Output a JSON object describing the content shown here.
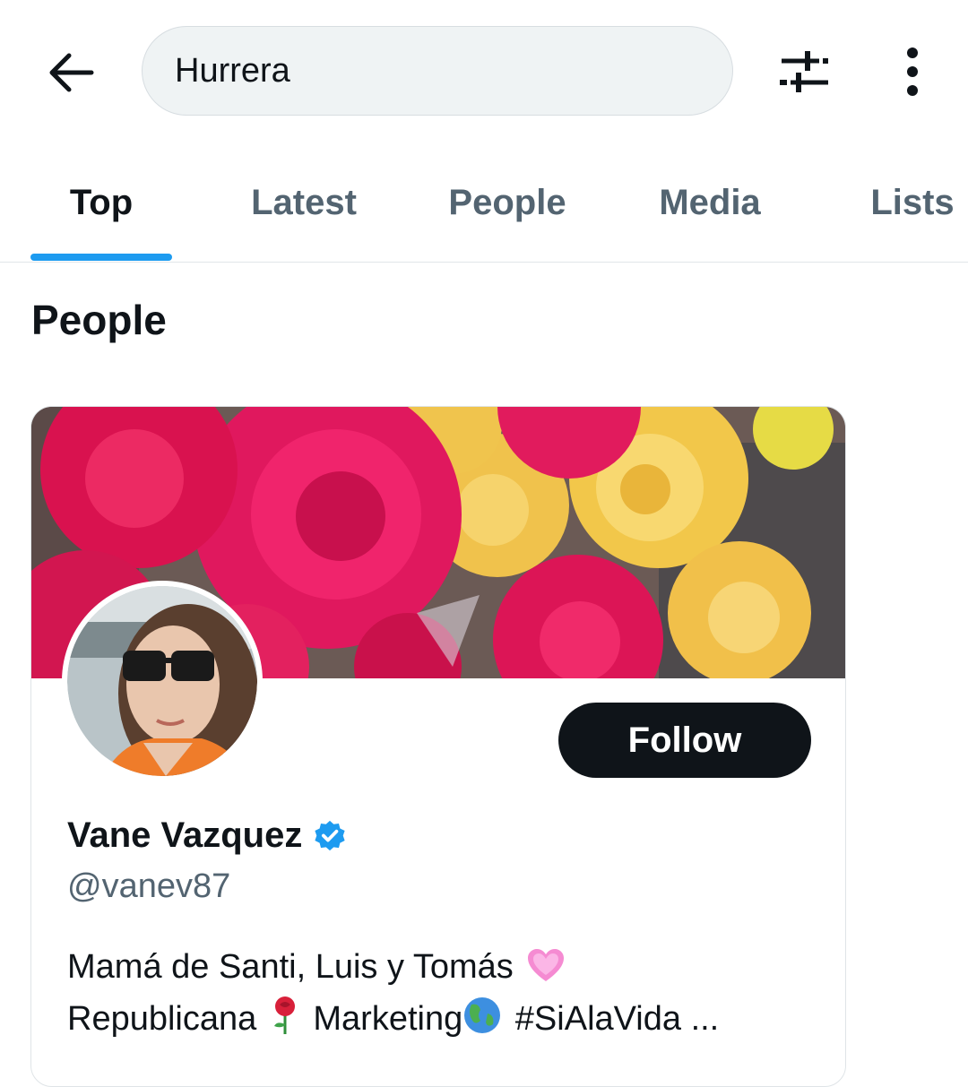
{
  "search": {
    "query": "Hurrera"
  },
  "tabs": [
    {
      "label": "Top",
      "active": true
    },
    {
      "label": "Latest",
      "active": false
    },
    {
      "label": "People",
      "active": false
    },
    {
      "label": "Media",
      "active": false
    },
    {
      "label": "Lists",
      "active": false
    }
  ],
  "section": {
    "title": "People"
  },
  "card": {
    "follow_label": "Follow",
    "name": "Vane Vazquez",
    "verified": true,
    "handle": "@vanev87",
    "bio": {
      "line1_text": "Mamá de Santi, Luis y Tomás",
      "line2_part1": "Republicana",
      "line2_part2": "Marketing",
      "line2_part3": "#SiAlaVida ..."
    }
  },
  "icons": {
    "back": "arrow-left-icon",
    "filter": "sliders-icon",
    "more": "vertical-dots-icon",
    "verified": "verified-badge-icon",
    "heart": "pink-heart-emoji",
    "rose": "rose-emoji",
    "globe": "globe-emoji"
  },
  "colors": {
    "accent": "#1d9bf0",
    "text_primary": "#0f1419",
    "text_secondary": "#536471",
    "search_bg": "#eff3f4"
  }
}
